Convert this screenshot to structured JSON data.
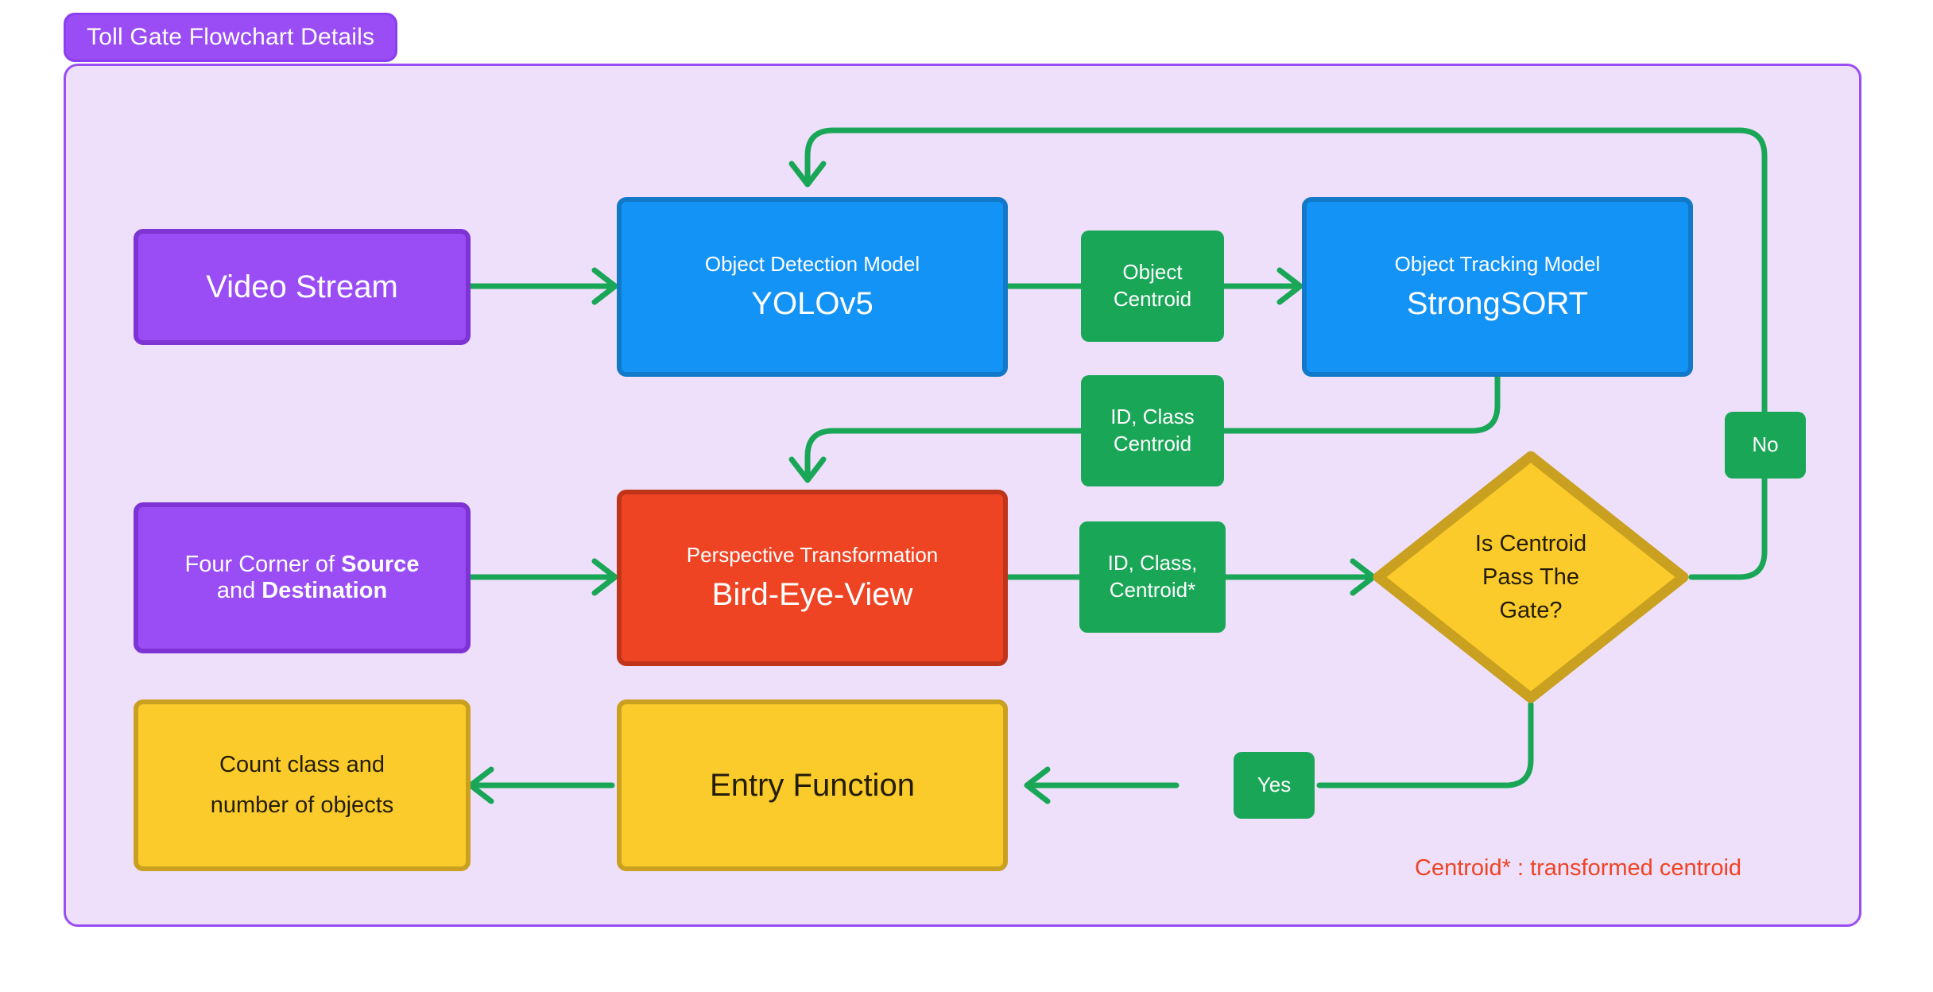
{
  "title": {
    "label": "Toll Gate Flowchart Details"
  },
  "colors": {
    "panel_bg": "#EEE0FB",
    "panel_border": "#9A4CF5",
    "purple": "#9A4CF5",
    "purple_border": "#7E33D4",
    "blue": "#1493F7",
    "blue_border": "#1278C8",
    "red": "#EF4423",
    "red_border": "#C0351A",
    "yellow": "#FBCB2B",
    "yellow_border": "#C9A01F",
    "green_edge": "#1AA657",
    "edge_label_bg": "#1AA657",
    "footnote_text": "#EF4423"
  },
  "nodes": {
    "video_stream": {
      "label": "Video Stream"
    },
    "detection": {
      "line1": "Object Detection Model",
      "line2": "YOLOv5"
    },
    "tracking": {
      "line1": "Object Tracking Model",
      "line2": "StrongSORT"
    },
    "four_corner": {
      "pre1": "Four Corner of ",
      "bold1": "Source",
      "pre2": "and ",
      "bold2": "Destination"
    },
    "perspective": {
      "line1": "Perspective Transformation",
      "line2": "Bird-Eye-View"
    },
    "decision": {
      "line1": "Is Centroid",
      "line2": "Pass The",
      "line3": "Gate?"
    },
    "entry_function": {
      "label": "Entry Function"
    },
    "count_class": {
      "line1": "Count class and",
      "line2": "number of objects"
    }
  },
  "edge_labels": {
    "object_centroid": {
      "line1": "Object",
      "line2": "Centroid"
    },
    "id_class_centroid": {
      "line1": "ID, Class",
      "line2": "Centroid"
    },
    "id_class_centroid_star": {
      "line1": "ID, Class,",
      "line2": "Centroid*"
    },
    "no": {
      "label": "No"
    },
    "yes": {
      "label": "Yes"
    }
  },
  "footnote": {
    "text": "Centroid* : transformed centroid"
  },
  "chart_data": {
    "type": "diagram",
    "title": "Toll Gate Flowchart Details",
    "nodes": [
      {
        "id": "video_stream",
        "text": "Video Stream",
        "shape": "rounded-rect",
        "color": "#9A4CF5",
        "row": 1,
        "col": 1
      },
      {
        "id": "detection",
        "text": "Object Detection Model / YOLOv5",
        "shape": "rounded-rect",
        "color": "#1493F7",
        "row": 1,
        "col": 2
      },
      {
        "id": "tracking",
        "text": "Object Tracking Model / StrongSORT",
        "shape": "rounded-rect",
        "color": "#1493F7",
        "row": 1,
        "col": 3
      },
      {
        "id": "four_corner",
        "text": "Four Corner of Source and Destination",
        "shape": "rounded-rect",
        "color": "#9A4CF5",
        "row": 2,
        "col": 1
      },
      {
        "id": "perspective",
        "text": "Perspective Transformation / Bird-Eye-View",
        "shape": "rounded-rect",
        "color": "#EF4423",
        "row": 2,
        "col": 2
      },
      {
        "id": "decision",
        "text": "Is Centroid Pass The Gate?",
        "shape": "diamond",
        "color": "#FBCB2B",
        "row": 2,
        "col": 3
      },
      {
        "id": "count_class",
        "text": "Count class and number of objects",
        "shape": "rounded-rect",
        "color": "#FBCB2B",
        "row": 3,
        "col": 1
      },
      {
        "id": "entry_function",
        "text": "Entry Function",
        "shape": "rounded-rect",
        "color": "#FBCB2B",
        "row": 3,
        "col": 2
      }
    ],
    "edges": [
      {
        "from": "video_stream",
        "to": "detection",
        "label": ""
      },
      {
        "from": "detection",
        "to": "tracking",
        "label": "Object Centroid"
      },
      {
        "from": "tracking",
        "to": "perspective",
        "label": "ID, Class Centroid"
      },
      {
        "from": "four_corner",
        "to": "perspective",
        "label": ""
      },
      {
        "from": "perspective",
        "to": "decision",
        "label": "ID, Class, Centroid*"
      },
      {
        "from": "decision",
        "to": "detection",
        "label": "No"
      },
      {
        "from": "decision",
        "to": "entry_function",
        "label": "Yes"
      },
      {
        "from": "entry_function",
        "to": "count_class",
        "label": ""
      }
    ],
    "annotations": [
      "Centroid* : transformed centroid"
    ]
  }
}
